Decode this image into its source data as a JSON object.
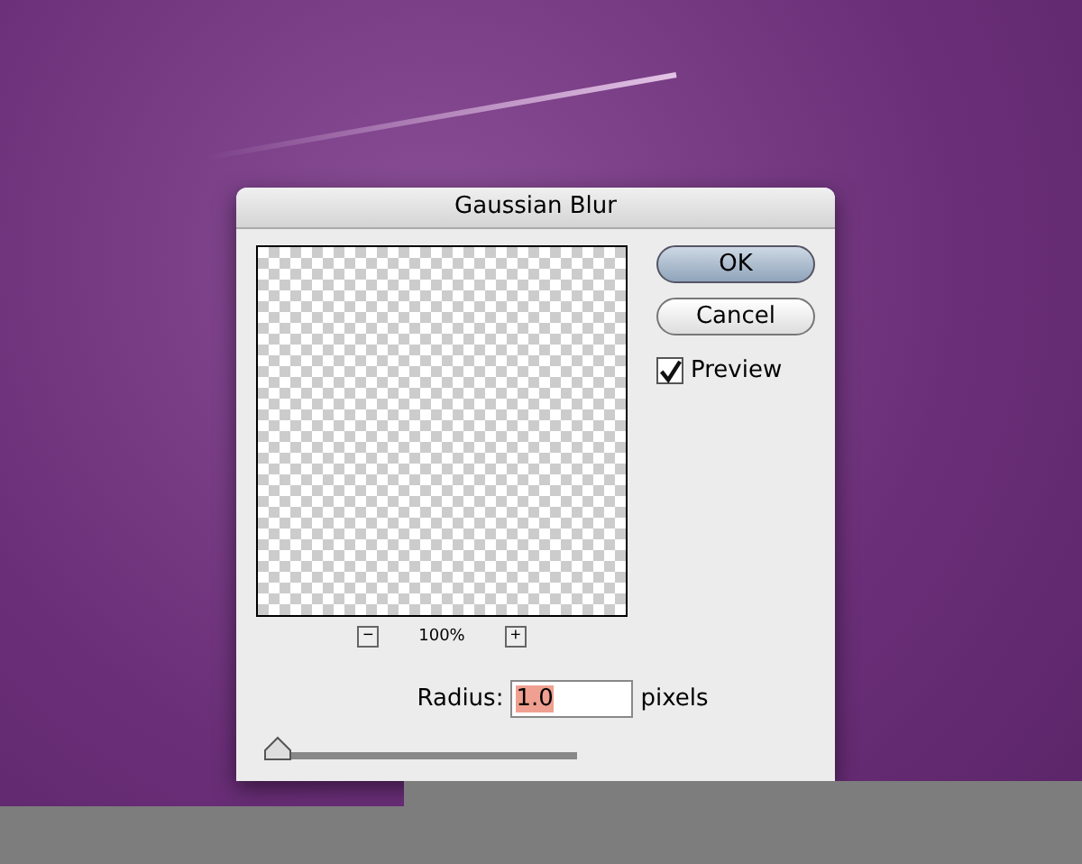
{
  "dialog": {
    "title": "Gaussian Blur",
    "zoom": {
      "out": "−",
      "value": "100%",
      "in": "+"
    },
    "buttons": [
      {
        "label": "OK",
        "default": true
      },
      {
        "label": "Cancel",
        "default": false
      }
    ],
    "preview": {
      "label": "Preview",
      "checked": true
    },
    "radius": {
      "label": "Radius:",
      "value": "1.0",
      "unit": "pixels",
      "level": 0.02
    }
  }
}
